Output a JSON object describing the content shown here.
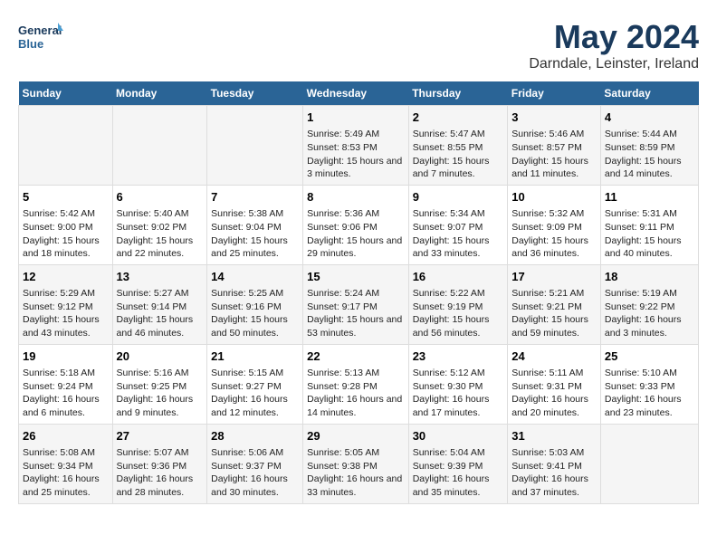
{
  "header": {
    "logo_line1": "General",
    "logo_line2": "Blue",
    "month": "May 2024",
    "location": "Darndale, Leinster, Ireland"
  },
  "days_of_week": [
    "Sunday",
    "Monday",
    "Tuesday",
    "Wednesday",
    "Thursday",
    "Friday",
    "Saturday"
  ],
  "weeks": [
    [
      {
        "day": "",
        "content": ""
      },
      {
        "day": "",
        "content": ""
      },
      {
        "day": "",
        "content": ""
      },
      {
        "day": "1",
        "content": "Sunrise: 5:49 AM\nSunset: 8:53 PM\nDaylight: 15 hours and 3 minutes."
      },
      {
        "day": "2",
        "content": "Sunrise: 5:47 AM\nSunset: 8:55 PM\nDaylight: 15 hours and 7 minutes."
      },
      {
        "day": "3",
        "content": "Sunrise: 5:46 AM\nSunset: 8:57 PM\nDaylight: 15 hours and 11 minutes."
      },
      {
        "day": "4",
        "content": "Sunrise: 5:44 AM\nSunset: 8:59 PM\nDaylight: 15 hours and 14 minutes."
      }
    ],
    [
      {
        "day": "5",
        "content": "Sunrise: 5:42 AM\nSunset: 9:00 PM\nDaylight: 15 hours and 18 minutes."
      },
      {
        "day": "6",
        "content": "Sunrise: 5:40 AM\nSunset: 9:02 PM\nDaylight: 15 hours and 22 minutes."
      },
      {
        "day": "7",
        "content": "Sunrise: 5:38 AM\nSunset: 9:04 PM\nDaylight: 15 hours and 25 minutes."
      },
      {
        "day": "8",
        "content": "Sunrise: 5:36 AM\nSunset: 9:06 PM\nDaylight: 15 hours and 29 minutes."
      },
      {
        "day": "9",
        "content": "Sunrise: 5:34 AM\nSunset: 9:07 PM\nDaylight: 15 hours and 33 minutes."
      },
      {
        "day": "10",
        "content": "Sunrise: 5:32 AM\nSunset: 9:09 PM\nDaylight: 15 hours and 36 minutes."
      },
      {
        "day": "11",
        "content": "Sunrise: 5:31 AM\nSunset: 9:11 PM\nDaylight: 15 hours and 40 minutes."
      }
    ],
    [
      {
        "day": "12",
        "content": "Sunrise: 5:29 AM\nSunset: 9:12 PM\nDaylight: 15 hours and 43 minutes."
      },
      {
        "day": "13",
        "content": "Sunrise: 5:27 AM\nSunset: 9:14 PM\nDaylight: 15 hours and 46 minutes."
      },
      {
        "day": "14",
        "content": "Sunrise: 5:25 AM\nSunset: 9:16 PM\nDaylight: 15 hours and 50 minutes."
      },
      {
        "day": "15",
        "content": "Sunrise: 5:24 AM\nSunset: 9:17 PM\nDaylight: 15 hours and 53 minutes."
      },
      {
        "day": "16",
        "content": "Sunrise: 5:22 AM\nSunset: 9:19 PM\nDaylight: 15 hours and 56 minutes."
      },
      {
        "day": "17",
        "content": "Sunrise: 5:21 AM\nSunset: 9:21 PM\nDaylight: 15 hours and 59 minutes."
      },
      {
        "day": "18",
        "content": "Sunrise: 5:19 AM\nSunset: 9:22 PM\nDaylight: 16 hours and 3 minutes."
      }
    ],
    [
      {
        "day": "19",
        "content": "Sunrise: 5:18 AM\nSunset: 9:24 PM\nDaylight: 16 hours and 6 minutes."
      },
      {
        "day": "20",
        "content": "Sunrise: 5:16 AM\nSunset: 9:25 PM\nDaylight: 16 hours and 9 minutes."
      },
      {
        "day": "21",
        "content": "Sunrise: 5:15 AM\nSunset: 9:27 PM\nDaylight: 16 hours and 12 minutes."
      },
      {
        "day": "22",
        "content": "Sunrise: 5:13 AM\nSunset: 9:28 PM\nDaylight: 16 hours and 14 minutes."
      },
      {
        "day": "23",
        "content": "Sunrise: 5:12 AM\nSunset: 9:30 PM\nDaylight: 16 hours and 17 minutes."
      },
      {
        "day": "24",
        "content": "Sunrise: 5:11 AM\nSunset: 9:31 PM\nDaylight: 16 hours and 20 minutes."
      },
      {
        "day": "25",
        "content": "Sunrise: 5:10 AM\nSunset: 9:33 PM\nDaylight: 16 hours and 23 minutes."
      }
    ],
    [
      {
        "day": "26",
        "content": "Sunrise: 5:08 AM\nSunset: 9:34 PM\nDaylight: 16 hours and 25 minutes."
      },
      {
        "day": "27",
        "content": "Sunrise: 5:07 AM\nSunset: 9:36 PM\nDaylight: 16 hours and 28 minutes."
      },
      {
        "day": "28",
        "content": "Sunrise: 5:06 AM\nSunset: 9:37 PM\nDaylight: 16 hours and 30 minutes."
      },
      {
        "day": "29",
        "content": "Sunrise: 5:05 AM\nSunset: 9:38 PM\nDaylight: 16 hours and 33 minutes."
      },
      {
        "day": "30",
        "content": "Sunrise: 5:04 AM\nSunset: 9:39 PM\nDaylight: 16 hours and 35 minutes."
      },
      {
        "day": "31",
        "content": "Sunrise: 5:03 AM\nSunset: 9:41 PM\nDaylight: 16 hours and 37 minutes."
      },
      {
        "day": "",
        "content": ""
      }
    ]
  ]
}
